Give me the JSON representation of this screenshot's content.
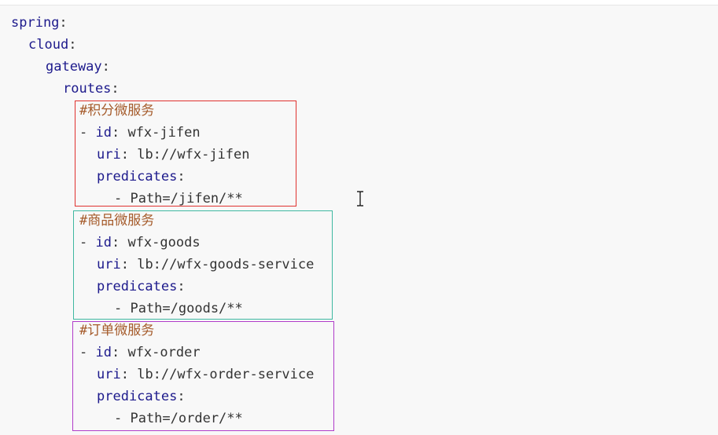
{
  "yaml": {
    "spring_key": "spring",
    "cloud_key": "cloud",
    "gateway_key": "gateway",
    "routes_key": "routes",
    "colon": ":",
    "routes": [
      {
        "comment": "#积分微服务",
        "dash": "- ",
        "id_key": "id",
        "id_value": " wfx-jifen",
        "uri_key": "uri",
        "uri_value": " lb://wfx-jifen",
        "predicates_key": "predicates",
        "predicate": "- Path=/jifen/**",
        "box_color": "#e0322f"
      },
      {
        "comment": "#商品微服务",
        "dash": "- ",
        "id_key": "id",
        "id_value": " wfx-goods",
        "uri_key": "uri",
        "uri_value": " lb://wfx-goods-service",
        "predicates_key": "predicates",
        "predicate": "- Path=/goods/**",
        "box_color": "#3fb8a1"
      },
      {
        "comment": "#订单微服务",
        "dash": "- ",
        "id_key": "id",
        "id_value": " wfx-order",
        "uri_key": "uri",
        "uri_value": " lb://wfx-order-service",
        "predicates_key": "predicates",
        "predicate": "- Path=/order/**",
        "box_color": "#b03cc9"
      }
    ]
  },
  "colors": {
    "key": "#1d1a8c",
    "comment": "#a55b2b",
    "text": "#333333",
    "background": "#f8f8f8"
  },
  "cursor": {
    "icon": "text-cursor-icon"
  }
}
